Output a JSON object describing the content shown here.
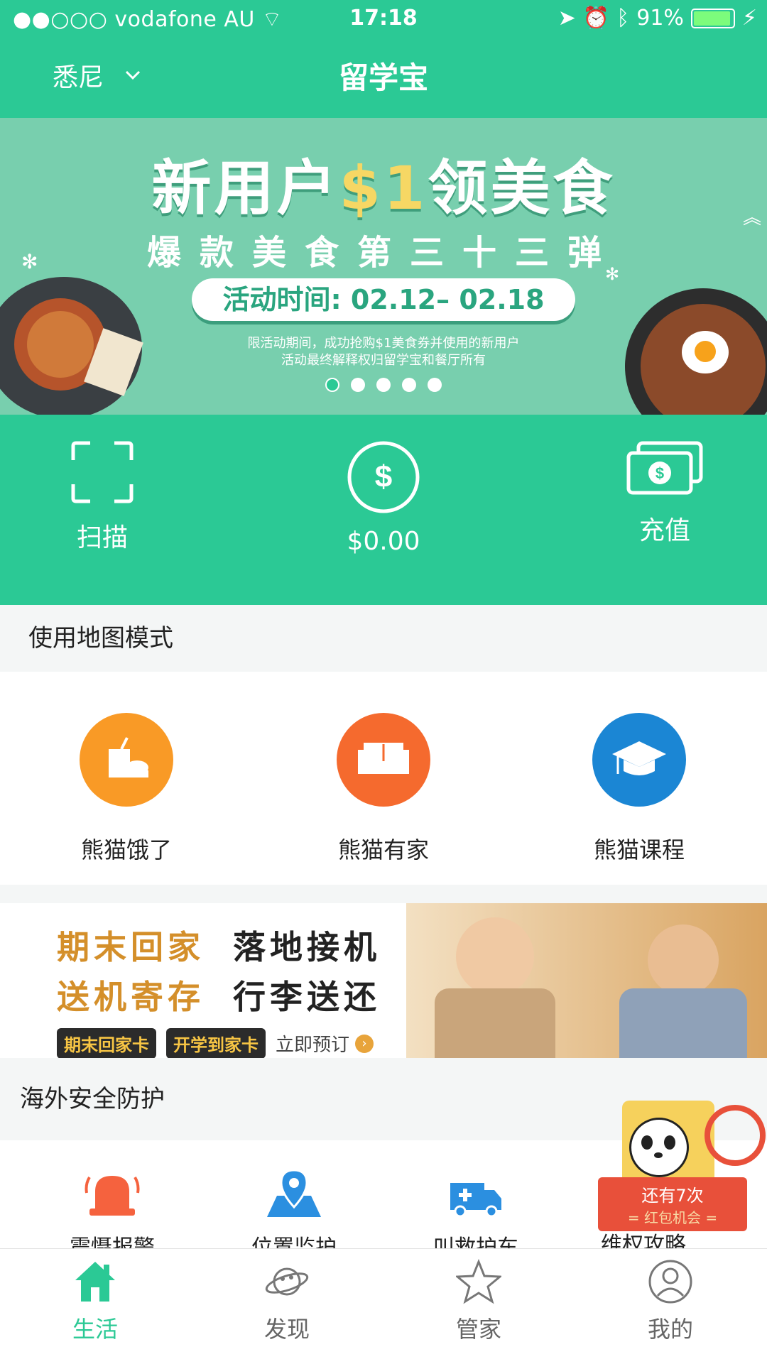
{
  "status_bar": {
    "carrier": "●●○○○ vodafone AU",
    "time": "17:18",
    "battery": "91%"
  },
  "header": {
    "city": "悉尼",
    "title": "留学宝"
  },
  "banner": {
    "title_prefix": "新用户",
    "title_amount": "$1",
    "title_suffix": "领美食",
    "subtitle": "爆款美食第三十三弹",
    "activity_time": "活动时间: 02.12– 02.18",
    "note_line1": "限活动期间，成功抢购$1美食券并使用的新用户",
    "note_line2": "活动最终解释权归留学宝和餐厅所有",
    "dots": 5,
    "active_dot": 1
  },
  "actions": {
    "scan_label": "扫描",
    "balance": "$0.00",
    "recharge_label": "充值"
  },
  "map_mode": {
    "label": "使用地图模式"
  },
  "services": [
    {
      "label": "熊猫饿了",
      "color": "#f99a26",
      "icon": "food-icon"
    },
    {
      "label": "熊猫有家",
      "color": "#f56a2e",
      "icon": "sofa-icon"
    },
    {
      "label": "熊猫课程",
      "color": "#1b86d4",
      "icon": "graduation-cap-icon"
    }
  ],
  "promo": {
    "line1_left": "期末回家",
    "line1_right": "落地接机",
    "line2_left": "送机寄存",
    "line2_right": "行李送还",
    "tag1": "期末回家卡",
    "tag2": "开学到家卡",
    "cta": "立即预订"
  },
  "safety": {
    "label": "海外安全防护",
    "items": [
      {
        "label": "震慑报警",
        "icon": "alarm-bell-icon"
      },
      {
        "label": "位置监护",
        "icon": "location-map-icon"
      },
      {
        "label": "叫救护车",
        "icon": "ambulance-icon"
      },
      {
        "label": "维权攻略",
        "icon": "guide-icon"
      }
    ]
  },
  "gift": {
    "line1": "还有7次",
    "line2": "= 红包机会 ="
  },
  "tabbar": [
    {
      "label": "生活",
      "icon": "home-icon",
      "active": true
    },
    {
      "label": "发现",
      "icon": "planet-icon",
      "active": false
    },
    {
      "label": "管家",
      "icon": "star-icon",
      "active": false
    },
    {
      "label": "我的",
      "icon": "user-icon",
      "active": false
    }
  ],
  "colors": {
    "brand": "#2bc995",
    "banner_bg": "#78cfae",
    "gold": "#f6d764"
  }
}
